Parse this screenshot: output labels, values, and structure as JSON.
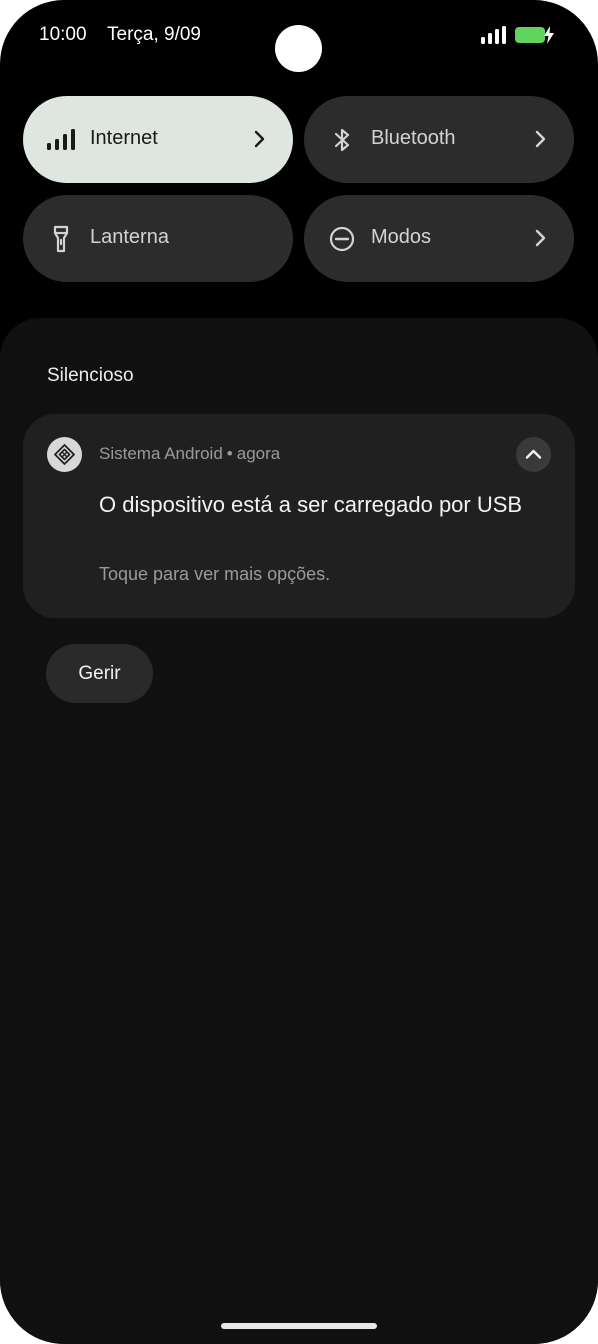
{
  "status_bar": {
    "time": "10:00",
    "date": "Terça, 9/09",
    "signal_icon": "signal-icon",
    "battery_icon": "battery-charging-icon",
    "battery_color": "#5fd45f"
  },
  "quick_settings": {
    "tiles": [
      {
        "label": "Internet",
        "icon": "signal-icon",
        "active": true,
        "has_chevron": true
      },
      {
        "label": "Bluetooth",
        "icon": "bluetooth-icon",
        "active": false,
        "has_chevron": true
      },
      {
        "label": "Lanterna",
        "icon": "flashlight-icon",
        "active": false,
        "has_chevron": false
      },
      {
        "label": "Modos",
        "icon": "do-not-disturb-icon",
        "active": false,
        "has_chevron": true
      }
    ],
    "active_color": "#dfe6df",
    "inactive_color": "#2c2c2c"
  },
  "notifications": {
    "section_title": "Silencioso",
    "items": [
      {
        "app_name": "Sistema Android",
        "separator": "•",
        "time": "agora",
        "title": "O dispositivo está a ser carregado por USB",
        "body": "Toque para ver mais opções.",
        "app_icon": "android-system-icon",
        "expand_icon": "chevron-up-icon"
      }
    ],
    "manage_label": "Gerir"
  }
}
